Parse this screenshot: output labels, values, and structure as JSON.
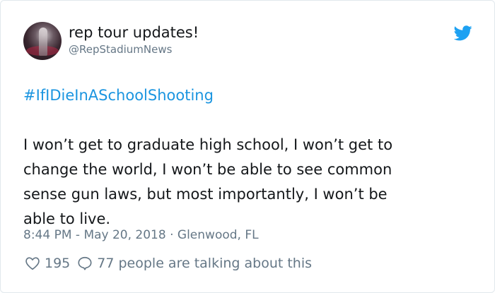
{
  "tweet": {
    "display_name": "rep tour updates!",
    "handle": "@RepStadiumNews",
    "hashtag": "#IfIDieInASchoolShooting",
    "text": "I won’t get to graduate high school, I won’t get to\nchange the world, I won’t be able to see common\nsense gun laws, but most importantly, I won’t be\nable to live.",
    "timestamp_location": "8:44 PM - May 20, 2018 · Glenwood, FL",
    "like_count": "195",
    "talk_text": "77 people are talking about this"
  },
  "icons": {
    "brand": "twitter-bird-icon",
    "like": "heart-icon",
    "reply": "speech-bubble-icon"
  },
  "colors": {
    "brand_blue": "#1da1f2",
    "hashtag_blue": "#1b95e0",
    "secondary_text": "#657786",
    "border": "#e1e8ed"
  }
}
